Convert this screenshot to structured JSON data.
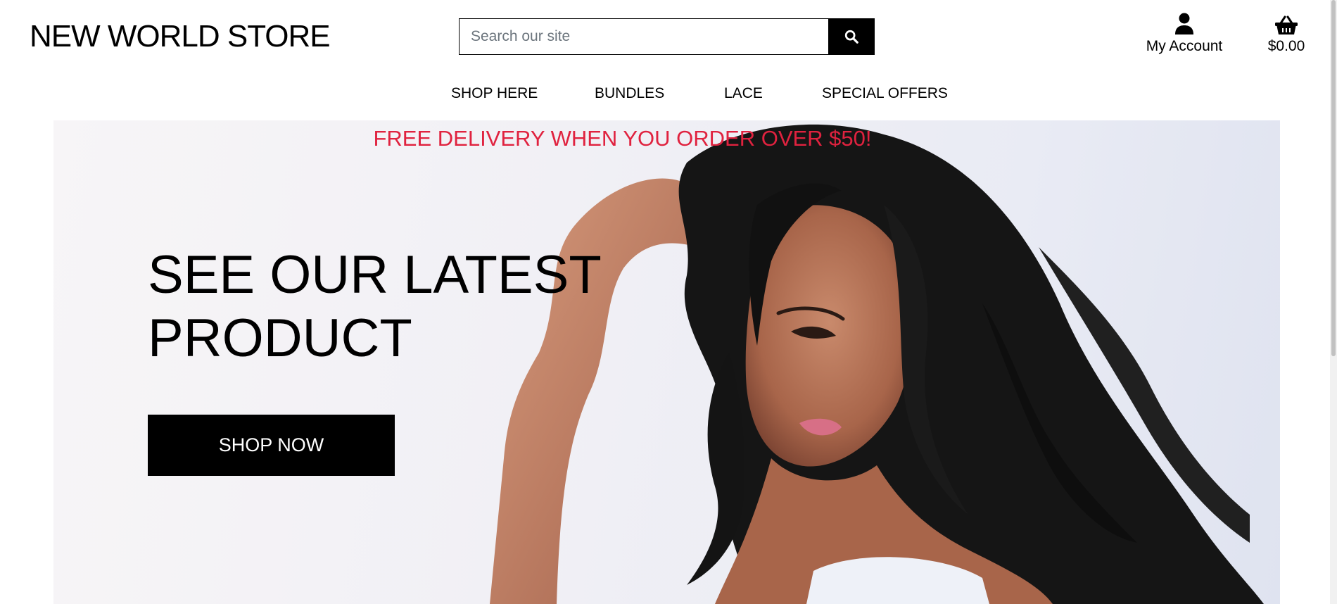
{
  "header": {
    "brand": "NEW WORLD STORE",
    "search": {
      "placeholder": "Search our site",
      "value": "",
      "button_icon": "search-icon"
    },
    "account": {
      "label": "My Account",
      "icon": "user-icon"
    },
    "basket": {
      "total": "$0.00",
      "icon": "shopping-basket-icon"
    }
  },
  "nav": {
    "items": [
      {
        "label": "SHOP HERE"
      },
      {
        "label": "BUNDLES"
      },
      {
        "label": "LACE"
      },
      {
        "label": "SPECIAL OFFERS"
      }
    ]
  },
  "hero": {
    "promo": "FREE DELIVERY WHEN YOU ORDER OVER $50!",
    "title_line1": "SEE OUR LATEST",
    "title_line2": "PRODUCT",
    "cta": "SHOP NOW"
  },
  "colors": {
    "promo": "#e0223f",
    "button_bg": "#000000",
    "button_text": "#ffffff",
    "text": "#000000"
  }
}
